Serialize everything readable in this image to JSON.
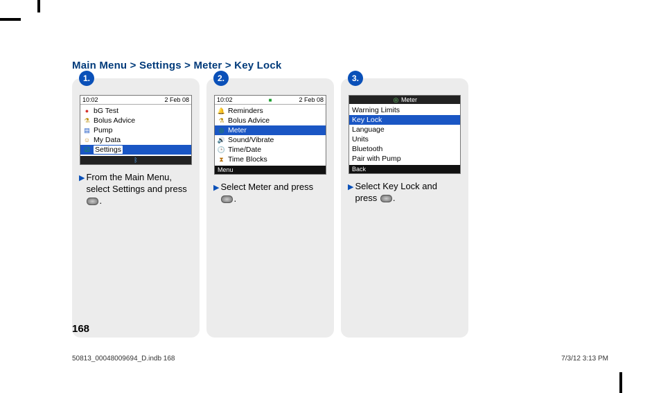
{
  "breadcrumb": "Main Menu > Settings > Meter > Key Lock",
  "page_number": "168",
  "footer_left": "50813_00048009694_D.indb   168",
  "footer_right": "7/3/12   3:13 PM",
  "panels": [
    {
      "step": "1.",
      "status_time": "10:02",
      "status_date": "2 Feb 08",
      "items": [
        {
          "icon": "drop-icon",
          "glyph": "●",
          "cls": "i-drop",
          "label": "bG Test",
          "selected": false
        },
        {
          "icon": "bolus-icon",
          "glyph": "⚗",
          "cls": "i-bolus",
          "label": "Bolus Advice",
          "selected": false
        },
        {
          "icon": "pump-icon",
          "glyph": "▤",
          "cls": "i-pump",
          "label": "Pump",
          "selected": false
        },
        {
          "icon": "data-icon",
          "glyph": "☺",
          "cls": "i-data",
          "label": "My Data",
          "selected": false
        },
        {
          "icon": "gear-icon",
          "glyph": "☑",
          "cls": "i-gear",
          "label": "Settings",
          "selected": true
        }
      ],
      "bt_bar": true,
      "caption_pre": "From the Main Menu, select Settings and press ",
      "caption_post": "."
    },
    {
      "step": "2.",
      "status_time": "10:02",
      "status_date": "2 Feb 08",
      "status_center_icon": true,
      "items": [
        {
          "icon": "bell-icon",
          "glyph": "🔔",
          "cls": "i-bell",
          "label": "Reminders",
          "selected": false
        },
        {
          "icon": "bolus-icon",
          "glyph": "⚗",
          "cls": "i-bolus",
          "label": "Bolus Advice",
          "selected": false
        },
        {
          "icon": "meter-icon",
          "glyph": "◎",
          "cls": "i-meter",
          "label": "Meter",
          "selected": true
        },
        {
          "icon": "sound-icon",
          "glyph": "🔊",
          "cls": "i-sound",
          "label": "Sound/Vibrate",
          "selected": false
        },
        {
          "icon": "clock-icon",
          "glyph": "🕒",
          "cls": "i-clock",
          "label": "Time/Date",
          "selected": false
        },
        {
          "icon": "blocks-icon",
          "glyph": "⧗",
          "cls": "i-blocks",
          "label": "Time Blocks",
          "selected": false
        }
      ],
      "soft_left": "Menu",
      "caption_pre": "Select Meter and press ",
      "caption_post": "."
    },
    {
      "step": "3.",
      "header_title": "Meter",
      "header_icon": "meter-icon",
      "items": [
        {
          "label": "Warning Limits",
          "selected": false
        },
        {
          "label": "Key Lock",
          "selected": true
        },
        {
          "label": "Language",
          "selected": false
        },
        {
          "label": "Units",
          "selected": false
        },
        {
          "label": "Bluetooth",
          "selected": false
        },
        {
          "label": "Pair with Pump",
          "selected": false
        }
      ],
      "soft_left": "Back",
      "caption_pre": "Select Key Lock and press ",
      "caption_post": "."
    }
  ]
}
